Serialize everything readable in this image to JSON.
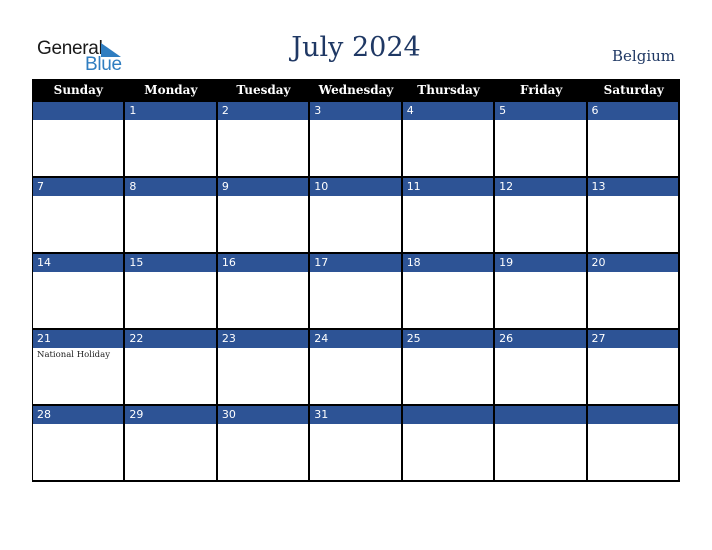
{
  "logo": {
    "part1": "General",
    "part2": "Blue",
    "icon": "triangle-flag-icon"
  },
  "header": {
    "title": "July 2024",
    "country": "Belgium"
  },
  "colors": {
    "header_bg": "#000000",
    "date_bar": "#2d5395",
    "title": "#1f3864",
    "logo_blue": "#2f7dc0"
  },
  "weekdays": [
    "Sunday",
    "Monday",
    "Tuesday",
    "Wednesday",
    "Thursday",
    "Friday",
    "Saturday"
  ],
  "weeks": [
    [
      {
        "d": "",
        "e": ""
      },
      {
        "d": "1",
        "e": ""
      },
      {
        "d": "2",
        "e": ""
      },
      {
        "d": "3",
        "e": ""
      },
      {
        "d": "4",
        "e": ""
      },
      {
        "d": "5",
        "e": ""
      },
      {
        "d": "6",
        "e": ""
      }
    ],
    [
      {
        "d": "7",
        "e": ""
      },
      {
        "d": "8",
        "e": ""
      },
      {
        "d": "9",
        "e": ""
      },
      {
        "d": "10",
        "e": ""
      },
      {
        "d": "11",
        "e": ""
      },
      {
        "d": "12",
        "e": ""
      },
      {
        "d": "13",
        "e": ""
      }
    ],
    [
      {
        "d": "14",
        "e": ""
      },
      {
        "d": "15",
        "e": ""
      },
      {
        "d": "16",
        "e": ""
      },
      {
        "d": "17",
        "e": ""
      },
      {
        "d": "18",
        "e": ""
      },
      {
        "d": "19",
        "e": ""
      },
      {
        "d": "20",
        "e": ""
      }
    ],
    [
      {
        "d": "21",
        "e": "National Holiday"
      },
      {
        "d": "22",
        "e": ""
      },
      {
        "d": "23",
        "e": ""
      },
      {
        "d": "24",
        "e": ""
      },
      {
        "d": "25",
        "e": ""
      },
      {
        "d": "26",
        "e": ""
      },
      {
        "d": "27",
        "e": ""
      }
    ],
    [
      {
        "d": "28",
        "e": ""
      },
      {
        "d": "29",
        "e": ""
      },
      {
        "d": "30",
        "e": ""
      },
      {
        "d": "31",
        "e": ""
      },
      {
        "d": "",
        "e": ""
      },
      {
        "d": "",
        "e": ""
      },
      {
        "d": "",
        "e": ""
      }
    ]
  ]
}
